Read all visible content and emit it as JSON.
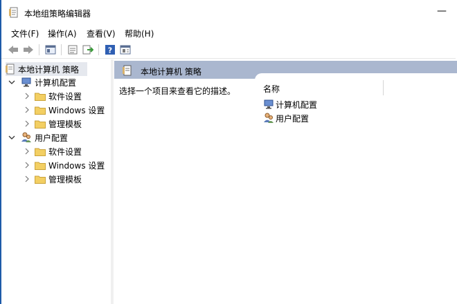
{
  "window": {
    "title": "本地组策略编辑器",
    "minimize_glyph": "—"
  },
  "menu": {
    "items": [
      "文件(F)",
      "操作(A)",
      "查看(V)",
      "帮助(H)"
    ]
  },
  "toolbar": {
    "buttons": [
      "back-arrow-icon",
      "forward-arrow-icon",
      "show-hide-tree-icon",
      "properties-icon",
      "export-list-icon",
      "help-icon",
      "view-icon"
    ]
  },
  "tree": {
    "root": "本地计算机 策略",
    "computer": {
      "label": "计算机配置",
      "children": [
        "软件设置",
        "Windows 设置",
        "管理模板"
      ]
    },
    "user": {
      "label": "用户配置",
      "children": [
        "软件设置",
        "Windows 设置",
        "管理模板"
      ]
    }
  },
  "details": {
    "header_title": "本地计算机 策略",
    "description": "选择一个项目来查看它的描述。",
    "column_name": "名称",
    "items": [
      "计算机配置",
      "用户配置"
    ]
  },
  "colors": {
    "header_band": "#aab7cf",
    "selection": "#e5e8ee",
    "folder": "#f3cf63",
    "window_border": "#1e5aa8"
  }
}
